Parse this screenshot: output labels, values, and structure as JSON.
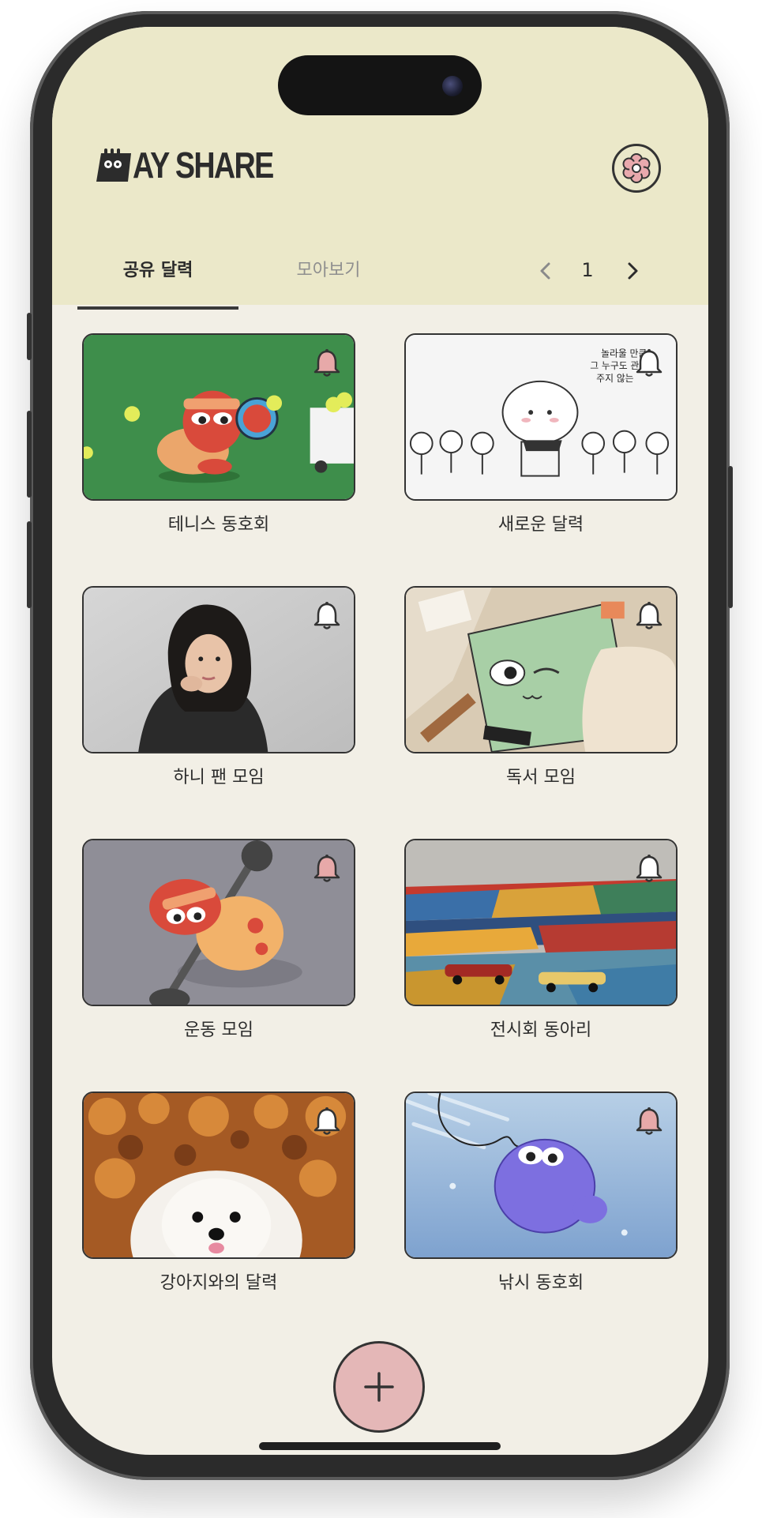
{
  "app": {
    "logo_text": "AY SHARE"
  },
  "icons": {
    "settings": "settings-flower-icon",
    "bell": "bell-icon",
    "add": "plus-icon"
  },
  "tabs": [
    {
      "label": "공유 달력",
      "active": true
    },
    {
      "label": "모아보기",
      "active": false
    }
  ],
  "pager": {
    "page": "1"
  },
  "colors": {
    "header": "#ebe8c9",
    "background": "#f2efe6",
    "bell_active": "#e7a9a9",
    "fab": "#e4b7b7"
  },
  "calendars": [
    {
      "label": "테니스 동호회",
      "bell": "pink",
      "image": "tennis-character"
    },
    {
      "label": "새로운 달력",
      "bell": "white",
      "image": "cloud-characters",
      "overlay_text": [
        "놀라울 만큼",
        "그 누구도 관",
        "주지 않는"
      ]
    },
    {
      "label": "하니 팬 모임",
      "bell": "white",
      "image": "person-photo"
    },
    {
      "label": "독서 모임",
      "bell": "white",
      "image": "book-character"
    },
    {
      "label": "운동 모임",
      "bell": "pink",
      "image": "workout-character"
    },
    {
      "label": "전시회 동아리",
      "bell": "white",
      "image": "painted-landscape-cars"
    },
    {
      "label": "강아지와의 달력",
      "bell": "white",
      "image": "dog-photo"
    },
    {
      "label": "낚시 동호회",
      "bell": "pink",
      "image": "fish-character"
    }
  ]
}
